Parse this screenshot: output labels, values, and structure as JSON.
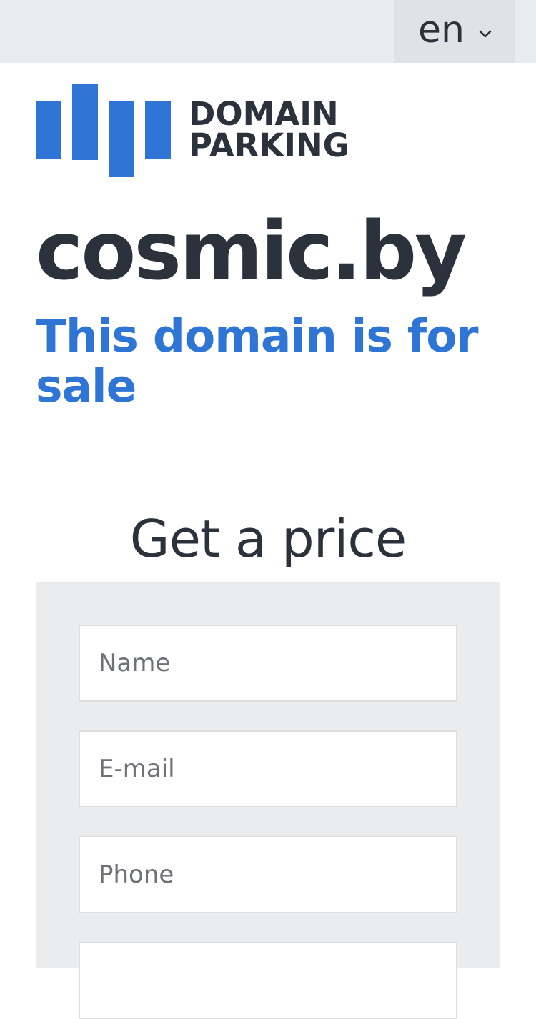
{
  "header": {
    "language_selected": "en",
    "language_chevron": "chevron-down-icon"
  },
  "logo": {
    "line1": "DOMAIN",
    "line2": "PARKING",
    "brand_color": "#2e75d6"
  },
  "hero": {
    "domain": "cosmic.by",
    "subtitle": "This domain is for sale"
  },
  "form": {
    "title": "Get a price",
    "fields": [
      {
        "placeholder": "Name",
        "value": ""
      },
      {
        "placeholder": "E-mail",
        "value": ""
      },
      {
        "placeholder": "Phone",
        "value": ""
      },
      {
        "placeholder": "",
        "value": ""
      }
    ]
  },
  "colors": {
    "accent": "#2e75d6",
    "text": "#2b323b",
    "panel": "#ebecee"
  }
}
